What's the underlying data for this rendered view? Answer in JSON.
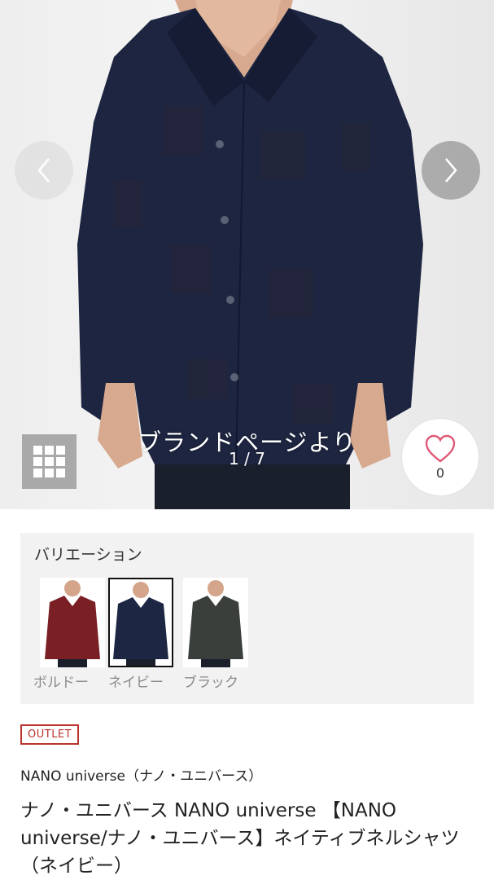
{
  "gallery": {
    "caption": "ブランドページより",
    "counter": "1 / 7",
    "favorite_count": "0"
  },
  "variations": {
    "title": "バリエーション",
    "items": [
      {
        "label": "ボルドー",
        "color": "#7a1f24",
        "selected": false
      },
      {
        "label": "ネイビー",
        "color": "#1d2744",
        "selected": true
      },
      {
        "label": "ブラック",
        "color": "#3a3f3c",
        "selected": false
      }
    ]
  },
  "product": {
    "badge": "OUTLET",
    "brand": "NANO universe（ナノ・ユニバース）",
    "name": "ナノ・ユニバース NANO universe 【NANO universe/ナノ・ユニバース】ネイティブネルシャツ（ネイビー）"
  },
  "colors": {
    "accent": "#b8342c",
    "shirt": "#1d2541"
  }
}
